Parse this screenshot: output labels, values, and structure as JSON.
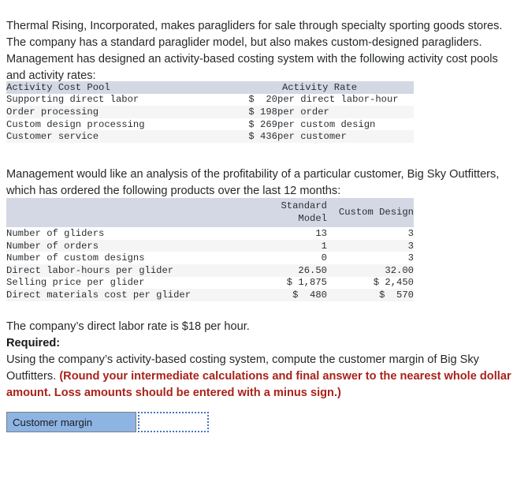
{
  "intro_paragraph": "Thermal Rising, Incorporated, makes paragliders for sale through specialty sporting goods stores. The company has a standard paraglider model, but also makes custom-designed paragliders. Management has designed an activity-based costing system with the following activity cost pools and activity rates:",
  "analysis_paragraph": "Management would like an analysis of the profitability of a particular customer, Big Sky Outfitters, which has ordered the following products over the last 12 months:",
  "labor_rate_paragraph": "The company’s direct labor rate is $18 per hour.",
  "required": {
    "heading": "Required:",
    "body_plain": "Using the company’s activity-based costing system, compute the customer margin of Big Sky Outfitters. ",
    "body_red": "(Round your intermediate calculations and final answer to the nearest whole dollar amount. Loss amounts should be entered with a minus sign.)"
  },
  "activity_rate_table": {
    "headers": [
      "Activity Cost Pool",
      "Activity Rate"
    ],
    "rows": [
      {
        "pool": "Supporting direct labor",
        "amount": "$  20",
        "unit": "per direct labor-hour"
      },
      {
        "pool": "Order processing",
        "amount": "$ 198",
        "unit": "per order"
      },
      {
        "pool": "Custom design processing",
        "amount": "$ 269",
        "unit": "per custom design"
      },
      {
        "pool": "Customer service",
        "amount": "$ 436",
        "unit": "per customer"
      }
    ]
  },
  "customer_orders_table": {
    "headers": [
      "",
      "Standard\nModel",
      "Custom Design"
    ],
    "header_col2_line1": "Standard",
    "header_col2_line2": "Model",
    "header_col3": "Custom Design",
    "rows": [
      {
        "item": "Number of gliders",
        "standard": "13",
        "custom": "3"
      },
      {
        "item": "Number of orders",
        "standard": "1",
        "custom": "3"
      },
      {
        "item": "Number of custom designs",
        "standard": "0",
        "custom": "3"
      },
      {
        "item": "Direct labor-hours per glider",
        "standard": "26.50",
        "custom": "32.00"
      },
      {
        "item": "Selling price per glider",
        "standard": "$ 1,875",
        "custom": "$ 2,450"
      },
      {
        "item": "Direct materials cost per glider",
        "standard": "$  480",
        "custom": "$  570"
      }
    ]
  },
  "answer_row": {
    "label": "Customer margin",
    "value": "",
    "placeholder": ""
  },
  "colors": {
    "table_header_bg": "#d3d8e4",
    "row_stripe_bg": "#f5f5f5",
    "answer_label_bg": "#8db4e3",
    "answer_input_border": "#4472c4",
    "red_emphasis": "#a8231a",
    "body_text": "#25282b"
  }
}
